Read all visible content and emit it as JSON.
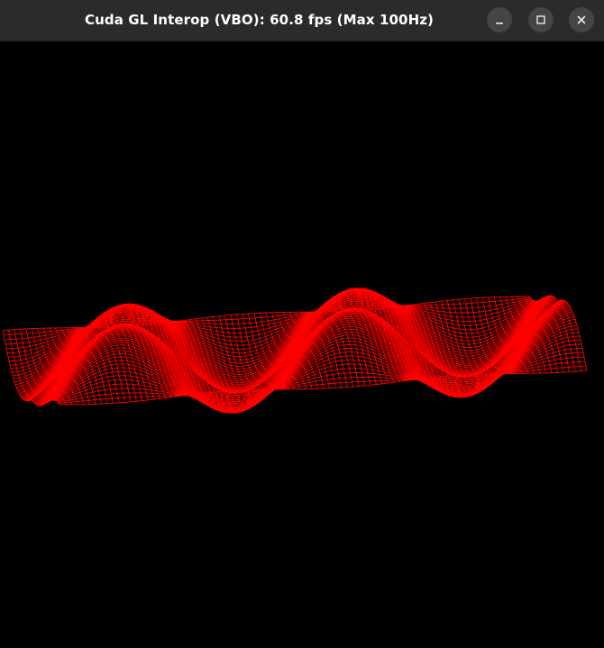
{
  "window": {
    "title": "Cuda GL Interop (VBO): 60.8 fps (Max 100Hz)",
    "controls": {
      "minimize_icon": "minimize-icon",
      "maximize_icon": "maximize-icon",
      "close_icon": "close-icon"
    }
  },
  "render": {
    "background": "#000000",
    "mesh_color": "#ff0000",
    "titlebar_color": "#2b2b2b"
  }
}
